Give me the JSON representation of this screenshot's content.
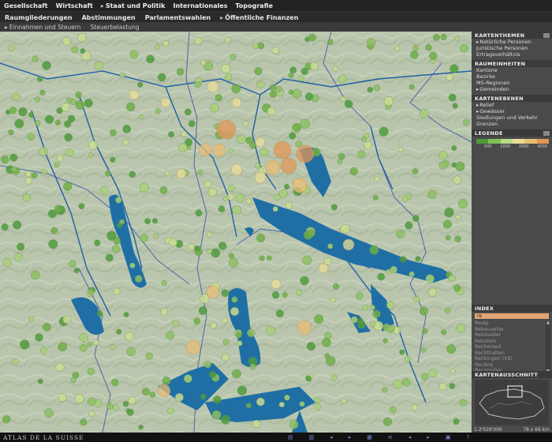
{
  "menu": {
    "items": [
      {
        "label": "Gesellschaft",
        "arrow": false
      },
      {
        "label": "Wirtschaft",
        "arrow": false
      },
      {
        "label": "Staat und Politik",
        "arrow": true
      },
      {
        "label": "Internationales",
        "arrow": false
      },
      {
        "label": "Topografie",
        "arrow": false
      }
    ]
  },
  "submenu": {
    "items": [
      {
        "label": "Raumgliederungen",
        "arrow": false
      },
      {
        "label": "Abstimmungen",
        "arrow": false
      },
      {
        "label": "Parlamentswahlen",
        "arrow": false
      },
      {
        "label": "Öffentliche Finanzen",
        "arrow": true
      }
    ]
  },
  "submenu2": {
    "items": [
      {
        "label": "Einnahmen und Steuern",
        "arrow": true
      },
      {
        "label": "Steuerbelastung",
        "arrow": false
      }
    ]
  },
  "panel": {
    "kartenthemen": {
      "title": "KARTENTHEMEN",
      "items": [
        "Natürliche Personen",
        "Juristische Personen",
        "Ertragsverhältnis"
      ],
      "selected": 0
    },
    "raumeinheiten": {
      "title": "RAUMEINHEITEN",
      "items": [
        "Kantone",
        "Bezirke",
        "MS-Regionen",
        "Gemeinden"
      ],
      "selected": 3
    },
    "kartenebenen": {
      "title": "KARTENEBENEN",
      "items": [
        "Relief",
        "Gewässer",
        "Siedlungen und Verkehr",
        "Grenzen"
      ],
      "selected": [
        0,
        1
      ]
    },
    "legende": {
      "title": "LEGENDE",
      "colors": [
        "#4f9b3c",
        "#7fbf55",
        "#b7d98a",
        "#e9dd9a",
        "#e8bd75",
        "#e19557"
      ],
      "ticks": [
        "500",
        "1000",
        "2000",
        "4000"
      ]
    },
    "index": {
      "title": "INDEX",
      "query": "re",
      "items": [
        "Realp",
        "Rebeuvelier",
        "Rebévelier",
        "Rebstein",
        "Recherswil",
        "Rechthalten",
        "Reckingen (VS)",
        "Reclère",
        "Reconvilier"
      ]
    },
    "ausschnitt": {
      "title": "KARTENAUSSCHNITT",
      "scale": "1:2'026'000",
      "size": "78 x 66 km"
    }
  },
  "footer": {
    "brand": "ATLAS DE LA SUISSE"
  },
  "colors": {
    "map_bg": "#b9c6ad",
    "lake": "#1f6fa5",
    "river": "#1f5fa8",
    "border": "#2e4fa6"
  }
}
